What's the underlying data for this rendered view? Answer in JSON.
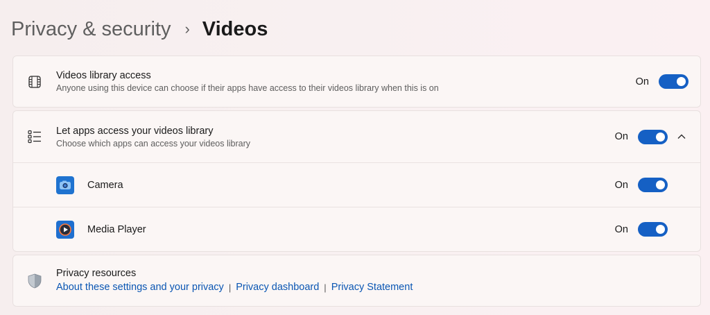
{
  "breadcrumb": {
    "parent": "Privacy & security",
    "separator": "›",
    "current": "Videos"
  },
  "library_access": {
    "icon": "film-frame-icon",
    "title": "Videos library access",
    "description": "Anyone using this device can choose if their apps have access to their videos library when this is on",
    "state_label": "On",
    "enabled": true
  },
  "apps_access": {
    "icon": "list-icon",
    "title": "Let apps access your videos library",
    "description": "Choose which apps can access your videos library",
    "state_label": "On",
    "enabled": true,
    "expanded": true,
    "apps": [
      {
        "name": "Camera",
        "icon": "camera-app-icon",
        "state_label": "On",
        "enabled": true
      },
      {
        "name": "Media Player",
        "icon": "media-player-icon",
        "state_label": "On",
        "enabled": true
      }
    ]
  },
  "resources": {
    "icon": "shield-icon",
    "title": "Privacy resources",
    "links": [
      "About these settings and your privacy",
      "Privacy dashboard",
      "Privacy Statement"
    ],
    "divider": "|"
  },
  "colors": {
    "accent": "#1560c4",
    "link": "#0a56b3"
  }
}
